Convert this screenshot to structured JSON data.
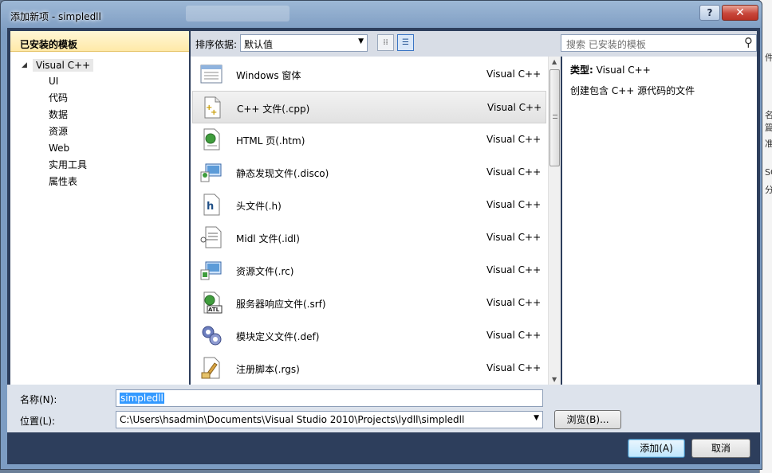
{
  "window": {
    "title": "添加新项 - simpledll",
    "help_label": "?",
    "close_label": "✕"
  },
  "left": {
    "header": "已安装的模板",
    "root": "Visual C++",
    "children": [
      "UI",
      "代码",
      "数据",
      "资源",
      "Web",
      "实用工具",
      "属性表"
    ]
  },
  "toolbar": {
    "sort_label": "排序依据:",
    "sort_value": "默认值",
    "search_placeholder": "搜索 已安装的模板"
  },
  "templates": [
    {
      "name": "Windows 窗体",
      "lang": "Visual C++",
      "icon": "windows-form-icon"
    },
    {
      "name": "C++ 文件(.cpp)",
      "lang": "Visual C++",
      "icon": "cpp-file-icon"
    },
    {
      "name": "HTML 页(.htm)",
      "lang": "Visual C++",
      "icon": "html-page-icon"
    },
    {
      "name": "静态发现文件(.disco)",
      "lang": "Visual C++",
      "icon": "disco-file-icon"
    },
    {
      "name": "头文件(.h)",
      "lang": "Visual C++",
      "icon": "header-file-icon"
    },
    {
      "name": "Midl 文件(.idl)",
      "lang": "Visual C++",
      "icon": "midl-file-icon"
    },
    {
      "name": "资源文件(.rc)",
      "lang": "Visual C++",
      "icon": "resource-file-icon"
    },
    {
      "name": "服务器响应文件(.srf)",
      "lang": "Visual C++",
      "icon": "srf-file-icon"
    },
    {
      "name": "模块定义文件(.def)",
      "lang": "Visual C++",
      "icon": "def-file-icon"
    },
    {
      "name": "注册脚本(.rgs)",
      "lang": "Visual C++",
      "icon": "rgs-file-icon"
    }
  ],
  "info": {
    "type_label": "类型:",
    "type_value": "Visual C++",
    "description": "创建包含 C++ 源代码的文件"
  },
  "form": {
    "name_label": "名称(N):",
    "name_value": "simpledll",
    "location_label": "位置(L):",
    "location_value": "C:\\Users\\hsadmin\\Documents\\Visual Studio 2010\\Projects\\lydll\\simpledll",
    "browse_label": "浏览(B)...",
    "add_label": "添加(A)",
    "cancel_label": "取消"
  },
  "colors": {
    "selection_highlight": "#3399ff",
    "header_gold": "#ffe9a8",
    "dialog_dark": "#2d3e5c"
  }
}
